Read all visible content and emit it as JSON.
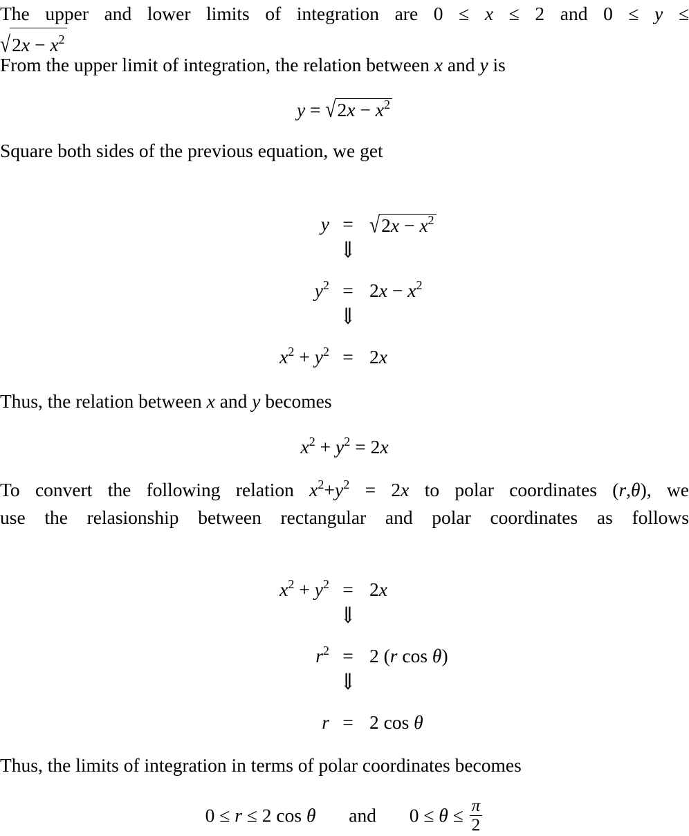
{
  "document": {
    "type": "math-solution",
    "topic": "Conversion of integration limits from rectangular to polar coordinates",
    "background_color": "#ffffff",
    "text_color": "#000000"
  },
  "symbols": {
    "leq": "≤",
    "sqrt": "√",
    "implies_down": "⇓",
    "theta": "θ",
    "pi": "π",
    "minus": "−",
    "plus": "+",
    "equals": "=",
    "times_x": "x",
    "lparen": "(",
    "rparen": ")"
  },
  "blocks": [
    {
      "id": "para-limits",
      "kind": "paragraph",
      "line1": {
        "t1": "The upper and lower limits of integration are 0",
        "leq1": "≤",
        "x": "x",
        "leq2": "≤",
        "two": "2",
        "and": "and",
        "zero2": "0",
        "leq3": "≤",
        "y": "y",
        "leq4": "≤"
      },
      "line2_radicand": {
        "sqrt": "√",
        "two": "2",
        "x": "x",
        "minus": "−",
        "x2_base": "x",
        "x2_exp": "2"
      }
    },
    {
      "id": "para-from-upper",
      "kind": "paragraph",
      "text": "From the upper limit of integration, the relation between x and y is",
      "run": {
        "a": "From the upper limit of integration, the relation between ",
        "x": "x",
        "b": " and ",
        "y": "y",
        "c": " is"
      }
    },
    {
      "id": "display-y-sqrt",
      "kind": "display-equation",
      "lhs": "y",
      "rel": "=",
      "sqrt": "√",
      "radicand": {
        "two": "2",
        "x": "x",
        "minus": "−",
        "x2_base": "x",
        "x2_exp": "2"
      }
    },
    {
      "id": "para-square-both-sides",
      "kind": "paragraph",
      "text": "Square both sides of the previous equation, we get"
    },
    {
      "id": "align-square",
      "kind": "aligned-equations",
      "rows": [
        {
          "lhs_plain": "y",
          "rel": "=",
          "rhs_kind": "radical",
          "rhs": {
            "sqrt": "√",
            "two": "2",
            "x": "x",
            "minus": "−",
            "x2_base": "x",
            "x2_exp": "2"
          }
        },
        {
          "arrow": "⇓"
        },
        {
          "lhs_kind": "power",
          "lhs": {
            "base": "y",
            "exp": "2"
          },
          "rel": "=",
          "rhs_kind": "poly",
          "rhs": {
            "two": "2",
            "x": "x",
            "minus": "−",
            "x2_base": "x",
            "x2_exp": "2"
          }
        },
        {
          "arrow": "⇓"
        },
        {
          "lhs_kind": "sum-of-powers",
          "lhs": {
            "b1": "x",
            "e1": "2",
            "plus": "+",
            "b2": "y",
            "e2": "2"
          },
          "rel": "=",
          "rhs_kind": "simple",
          "rhs": {
            "two": "2",
            "x": "x"
          }
        }
      ]
    },
    {
      "id": "para-thus-relation",
      "kind": "paragraph",
      "run": {
        "a": "Thus, the relation between ",
        "x": "x",
        "b": " and ",
        "y": "y",
        "c": " becomes"
      }
    },
    {
      "id": "display-circle",
      "kind": "display-equation",
      "parts": {
        "b1": "x",
        "e1": "2",
        "plus": "+",
        "b2": "y",
        "e2": "2",
        "rel": "=",
        "two": "2",
        "x": "x"
      }
    },
    {
      "id": "para-convert",
      "kind": "paragraph",
      "line1": {
        "a": "To convert the following relation ",
        "b1": "x",
        "e1": "2",
        "plus": "+",
        "b2": "y",
        "e2": "2",
        "rel": "=",
        "two": "2",
        "x": "x",
        "b": " to polar coordinates ",
        "lp": "(",
        "r": "r",
        "comma": ",",
        "theta": "θ",
        "rp": ")",
        "c": ", we"
      },
      "line2": "use the relasionship between rectangular and polar coordinates as follows"
    },
    {
      "id": "align-polar",
      "kind": "aligned-equations",
      "rows": [
        {
          "lhs_kind": "sum-of-powers",
          "lhs": {
            "b1": "x",
            "e1": "2",
            "plus": "+",
            "b2": "y",
            "e2": "2"
          },
          "rel": "=",
          "rhs_kind": "simple",
          "rhs": {
            "two": "2",
            "x": "x"
          }
        },
        {
          "arrow": "⇓"
        },
        {
          "lhs_kind": "power",
          "lhs": {
            "base": "r",
            "exp": "2"
          },
          "rel": "=",
          "rhs_kind": "paren-cos",
          "rhs": {
            "two": "2",
            "lp": "(",
            "r": "r",
            "cos": "cos",
            "theta": "θ",
            "rp": ")"
          }
        },
        {
          "arrow": "⇓"
        },
        {
          "lhs_plain": "r",
          "rel": "=",
          "rhs_kind": "cos",
          "rhs": {
            "two": "2",
            "cos": "cos",
            "theta": "θ"
          }
        }
      ]
    },
    {
      "id": "para-thus-limits",
      "kind": "paragraph",
      "text": "Thus, the limits of integration in terms of polar coordinates becomes"
    },
    {
      "id": "display-polar-limits",
      "kind": "display-equation",
      "parts": {
        "zero1": "0",
        "leq1": "≤",
        "r": "r",
        "leq2": "≤",
        "two": "2",
        "cos": "cos",
        "theta1": "θ",
        "and": "and",
        "zero2": "0",
        "leq3": "≤",
        "theta2": "θ",
        "leq4": "≤",
        "pi": "π",
        "den2": "2"
      }
    }
  ]
}
